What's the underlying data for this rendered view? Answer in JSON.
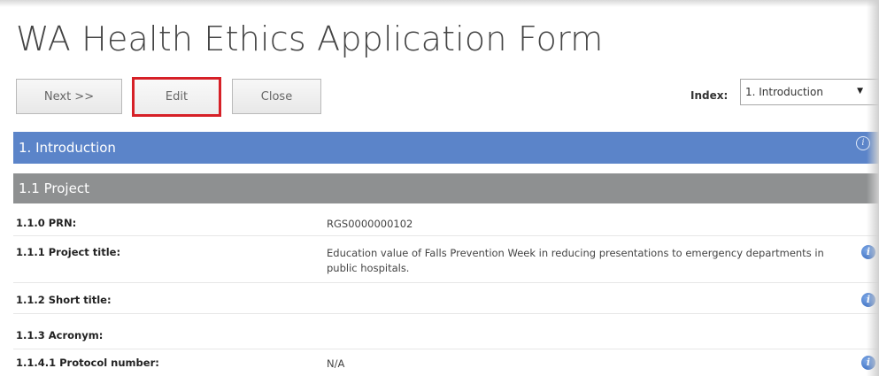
{
  "page": {
    "title": "WA Health Ethics Application Form"
  },
  "toolbar": {
    "next_label": "Next >>",
    "edit_label": "Edit",
    "close_label": "Close"
  },
  "index": {
    "label": "Index:",
    "selected": "1. Introduction"
  },
  "section": {
    "title": "1. Introduction",
    "info_icon": "info-icon"
  },
  "subsection": {
    "title": "1.1 Project"
  },
  "fields": [
    {
      "label": "1.1.0 PRN:",
      "value": "RGS0000000102",
      "help": false
    },
    {
      "label": "1.1.1 Project title:",
      "value": "Education value of Falls Prevention Week in reducing presentations to emergency departments in public hospitals.",
      "help": true
    },
    {
      "label": "1.1.2 Short title:",
      "value": "",
      "help": true
    },
    {
      "label": "1.1.3 Acronym:",
      "value": "",
      "help": false
    },
    {
      "label": "1.1.4.1 Protocol number:",
      "value": "N/A",
      "help": true
    }
  ],
  "colors": {
    "section_bar": "#5b84c9",
    "subsection_bar": "#8e9091",
    "edit_highlight": "#d62027",
    "help_icon": "#2f63b9"
  }
}
